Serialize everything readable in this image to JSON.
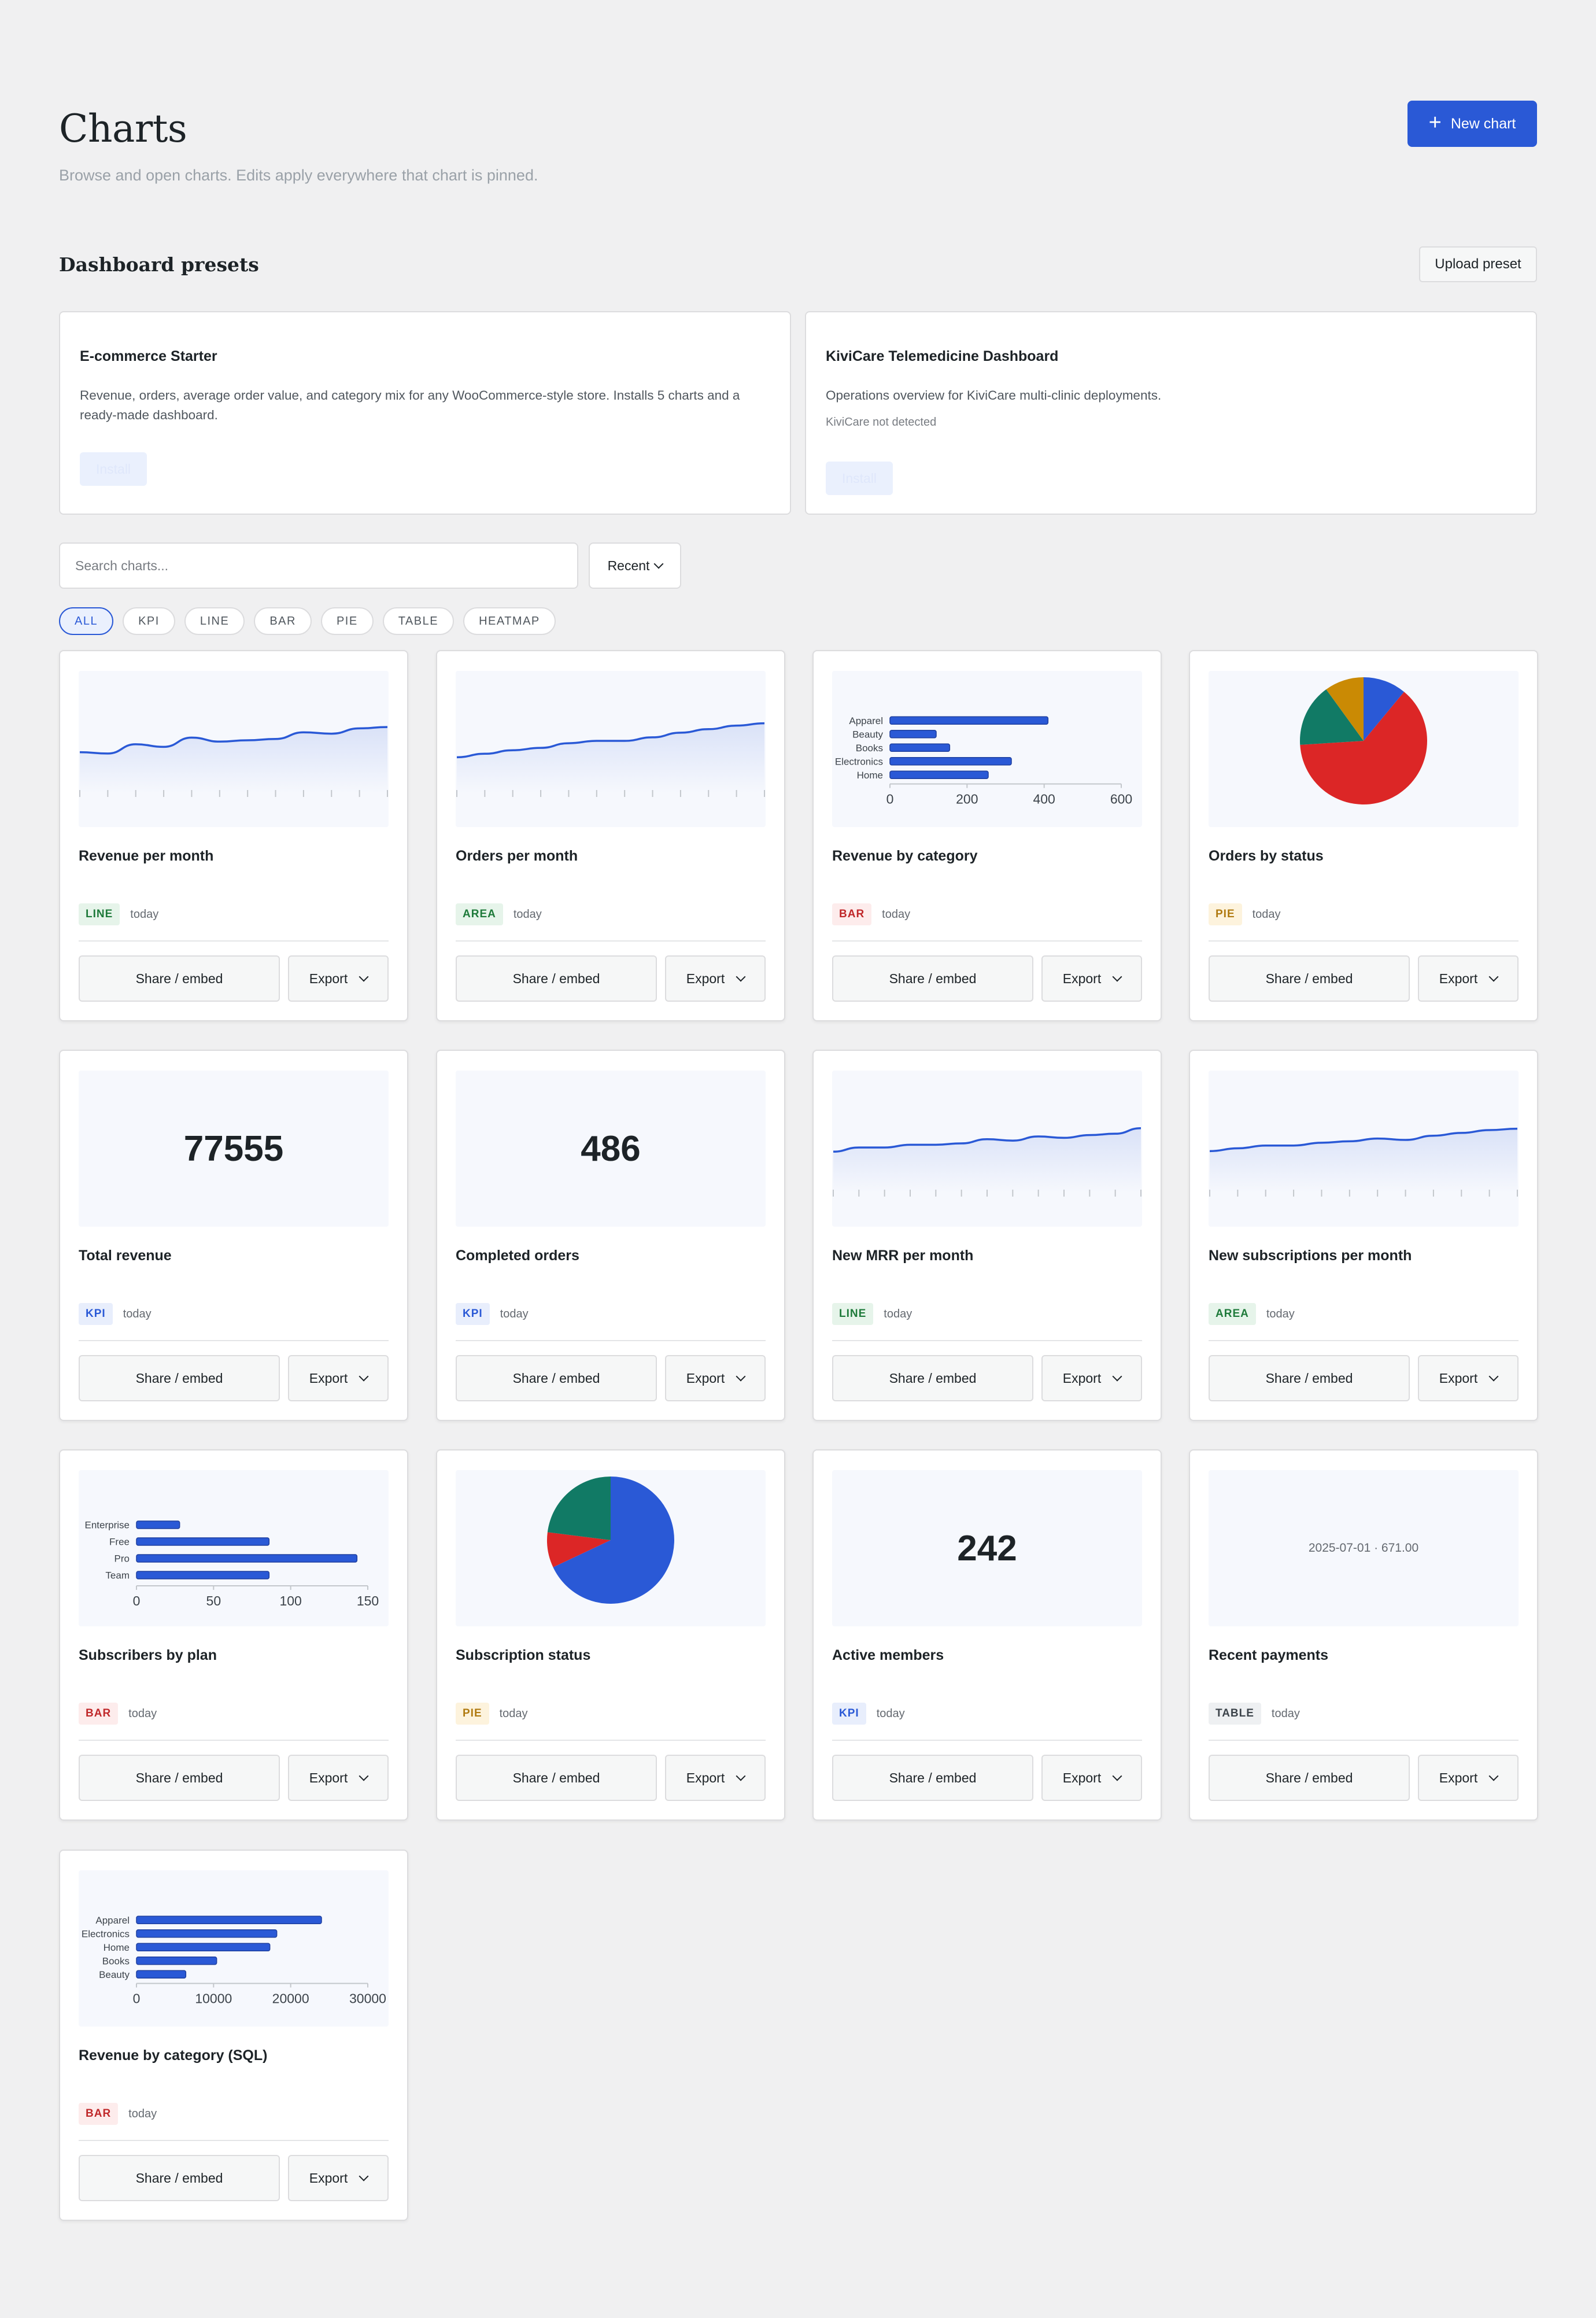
{
  "header": {
    "title": "Charts",
    "subtitle": "Browse and open charts. Edits apply everywhere that chart is pinned.",
    "new_chart_label": "New chart"
  },
  "presets": {
    "title": "Dashboard presets",
    "upload_label": "Upload preset",
    "items": [
      {
        "name": "E-commerce Starter",
        "description": "Revenue, orders, average order value, and category mix for any WooCommerce-style store. Installs 5 charts and a ready-made dashboard.",
        "note": "",
        "install_label": "Install"
      },
      {
        "name": "KiviCare Telemedicine Dashboard",
        "description": "Operations overview for KiviCare multi-clinic deployments.",
        "note": "KiviCare not detected",
        "install_label": "Install"
      }
    ]
  },
  "search": {
    "placeholder": "Search charts...",
    "sort_label": "Recent"
  },
  "filters": [
    "ALL",
    "KPI",
    "LINE",
    "BAR",
    "PIE",
    "TABLE",
    "HEATMAP"
  ],
  "active_filter": "ALL",
  "actions": {
    "share_label": "Share / embed",
    "export_label": "Export"
  },
  "colors": {
    "accent": "#2a59d6",
    "pie_blue": "#2a59d6",
    "pie_red": "#dc2626",
    "pie_teal": "#117a65",
    "pie_gold": "#ca8a04"
  },
  "charts": [
    {
      "title": "Revenue per month",
      "type_label": "LINE",
      "updated": "today",
      "chart_data": {
        "type": "line",
        "values": [
          52,
          51,
          58,
          56,
          63,
          60,
          61,
          62,
          67,
          66,
          70,
          71
        ]
      }
    },
    {
      "title": "Orders per month",
      "type_label": "AREA",
      "updated": "today",
      "chart_data": {
        "type": "area",
        "values": [
          33,
          36,
          39,
          41,
          45,
          47,
          47,
          50,
          54,
          57,
          60,
          62
        ]
      }
    },
    {
      "title": "Revenue by category",
      "type_label": "BAR",
      "updated": "today",
      "chart_data": {
        "type": "bar",
        "orientation": "horizontal",
        "categories": [
          "Apparel",
          "Beauty",
          "Books",
          "Electronics",
          "Home"
        ],
        "values": [
          410,
          120,
          155,
          315,
          255
        ],
        "xlim": [
          0,
          600
        ],
        "xticks": [
          "0",
          "200",
          "400",
          "600"
        ]
      }
    },
    {
      "title": "Orders by status",
      "type_label": "PIE",
      "updated": "today",
      "chart_data": {
        "type": "pie",
        "values": [
          11,
          63,
          16,
          10
        ],
        "colors": [
          "#2a59d6",
          "#dc2626",
          "#117a65",
          "#ca8a04"
        ]
      }
    },
    {
      "title": "Total revenue",
      "type_label": "KPI",
      "updated": "today",
      "kpi_value": "77555"
    },
    {
      "title": "Completed orders",
      "type_label": "KPI",
      "updated": "today",
      "kpi_value": "486"
    },
    {
      "title": "New MRR per month",
      "type_label": "LINE",
      "updated": "today",
      "chart_data": {
        "type": "line",
        "values": [
          40,
          43,
          43,
          45,
          45,
          46,
          49,
          48,
          51,
          50,
          52,
          53,
          57
        ]
      }
    },
    {
      "title": "New subscriptions per month",
      "type_label": "AREA",
      "updated": "today",
      "chart_data": {
        "type": "area",
        "values": [
          42,
          44,
          46,
          46,
          48,
          49,
          51,
          50,
          53,
          55,
          57,
          58
        ]
      }
    },
    {
      "title": "Subscribers by plan",
      "type_label": "BAR",
      "updated": "today",
      "chart_data": {
        "type": "bar",
        "orientation": "horizontal",
        "categories": [
          "Enterprise",
          "Free",
          "Pro",
          "Team"
        ],
        "values": [
          28,
          86,
          143,
          86
        ],
        "xlim": [
          0,
          150
        ],
        "xticks": [
          "0",
          "50",
          "100",
          "150"
        ]
      }
    },
    {
      "title": "Subscription status",
      "type_label": "PIE",
      "updated": "today",
      "chart_data": {
        "type": "pie",
        "values": [
          68,
          9,
          23
        ],
        "colors": [
          "#2a59d6",
          "#dc2626",
          "#117a65"
        ]
      }
    },
    {
      "title": "Active members",
      "type_label": "KPI",
      "updated": "today",
      "kpi_value": "242"
    },
    {
      "title": "Recent payments",
      "type_label": "TABLE",
      "updated": "today",
      "table_value": "2025-07-01 · 671.00"
    },
    {
      "title": "Revenue by category (SQL)",
      "type_label": "BAR",
      "updated": "today",
      "chart_data": {
        "type": "bar",
        "orientation": "horizontal",
        "categories": [
          "Apparel",
          "Electronics",
          "Home",
          "Books",
          "Beauty"
        ],
        "values": [
          24000,
          18200,
          17300,
          10400,
          6400
        ],
        "xlim": [
          0,
          30000
        ],
        "xticks": [
          "0",
          "10000",
          "20000",
          "30000"
        ]
      }
    }
  ]
}
